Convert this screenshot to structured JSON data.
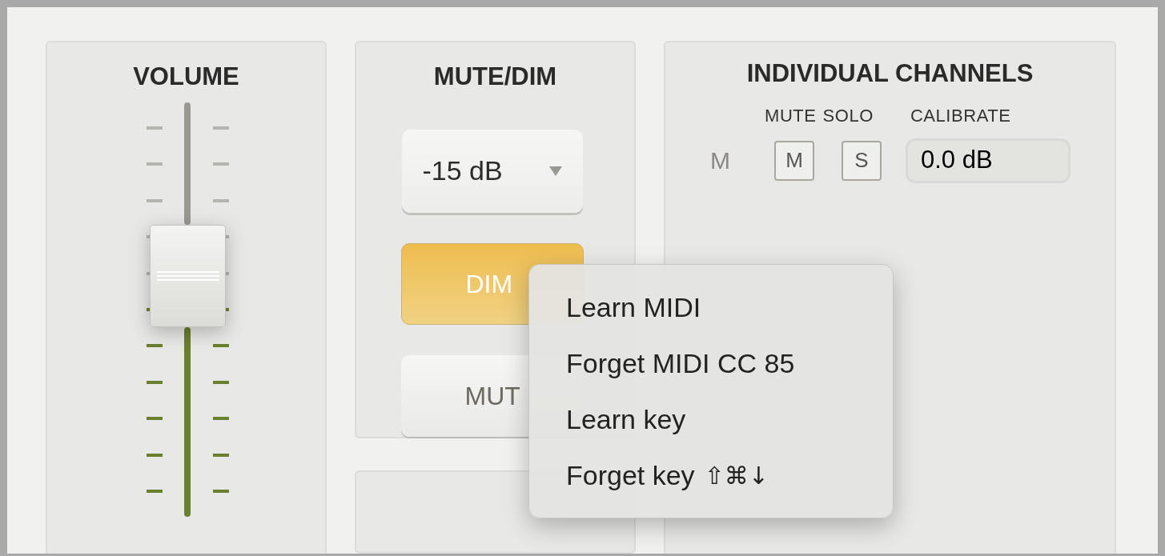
{
  "volume": {
    "title": "VOLUME",
    "level": 0.58
  },
  "mute_dim": {
    "title": "MUTE/DIM",
    "dim_amount": "-15 dB",
    "dim_button": {
      "label": "DIM",
      "on": true
    },
    "mute_button": {
      "label": "MUT",
      "on": false
    }
  },
  "individual_channels": {
    "title": "INDIVIDUAL CHANNELS",
    "columns": [
      "MUTE",
      "SOLO",
      "CALIBRATE"
    ],
    "channels": [
      {
        "name": "M",
        "mute_label": "M",
        "muted": false,
        "solo_label": "S",
        "soloed": false,
        "calibrate": "0.0 dB"
      }
    ]
  },
  "context_menu": {
    "items": [
      {
        "label": "Learn MIDI"
      },
      {
        "label": "Forget MIDI CC 85"
      },
      {
        "label": "Learn key"
      },
      {
        "label": "Forget key",
        "shortcut": "⇧⌘↓"
      }
    ]
  }
}
